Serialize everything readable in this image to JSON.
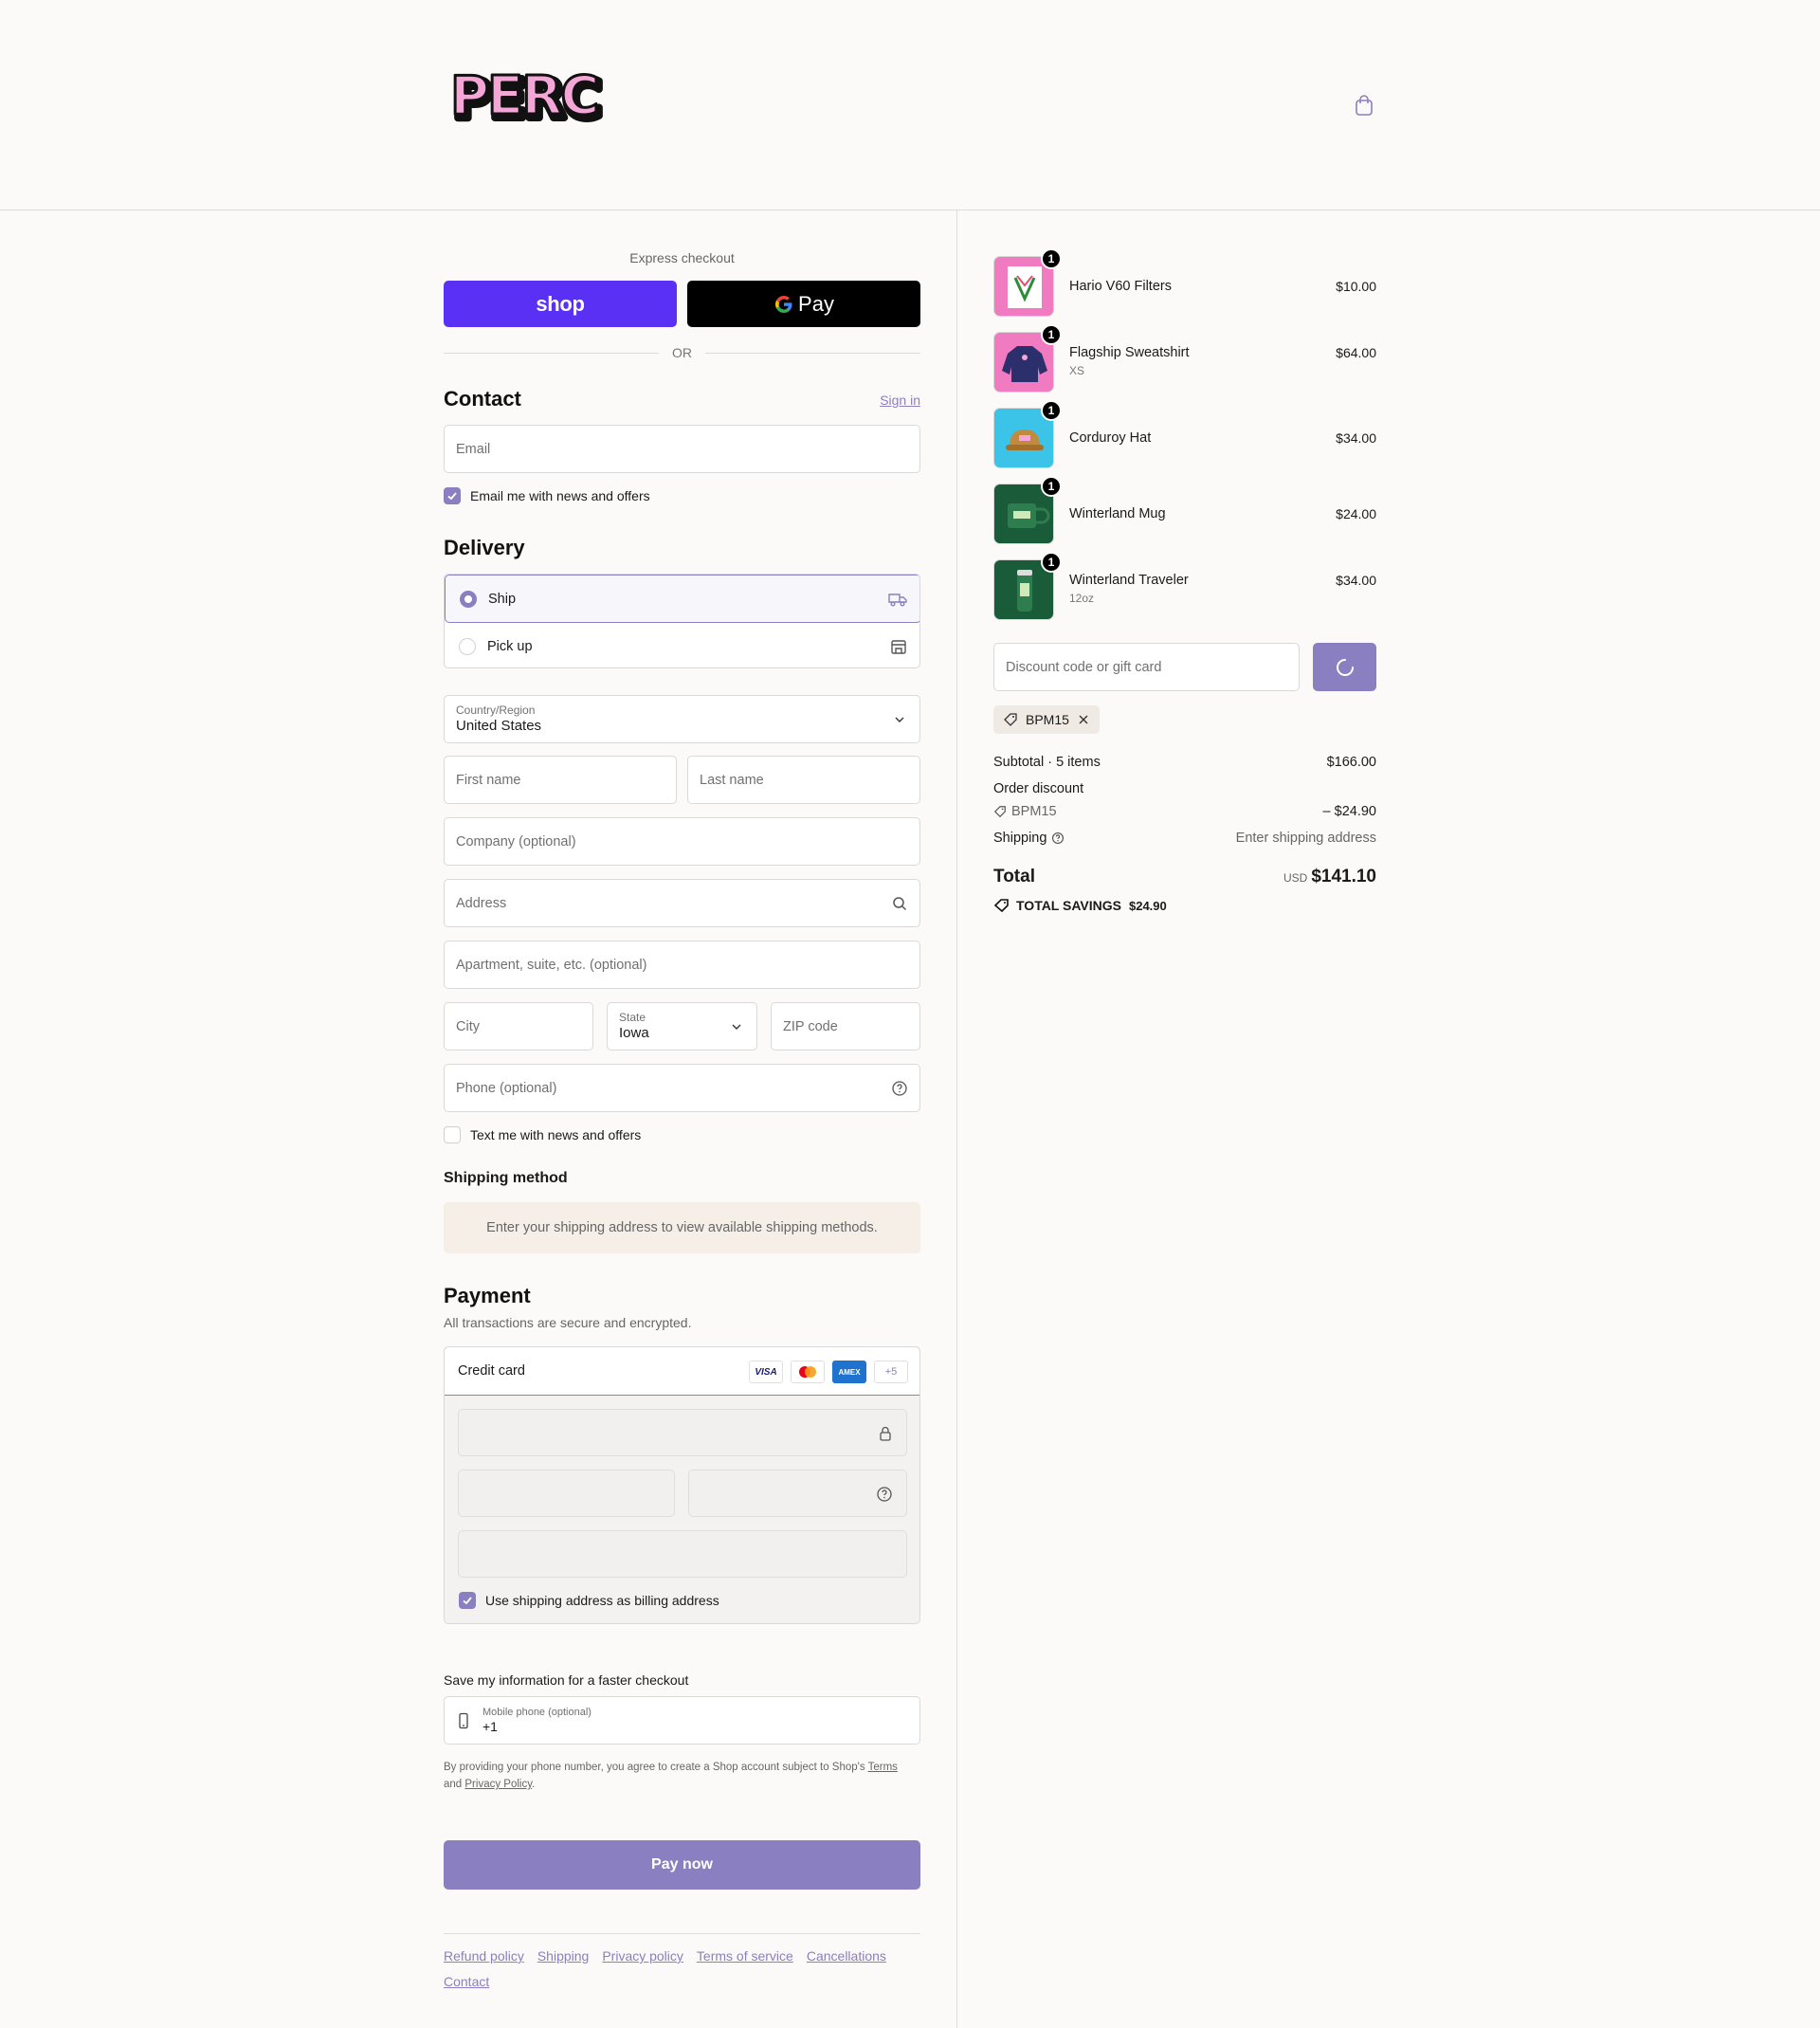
{
  "header": {
    "logo_text": "PERC",
    "cart_icon": "bag-icon"
  },
  "express": {
    "label": "Express checkout",
    "shop_label": "shop",
    "gpay_label": "Pay",
    "or_label": "OR"
  },
  "contact": {
    "title": "Contact",
    "sign_in": "Sign in",
    "email_placeholder": "Email",
    "news_label": "Email me with news and offers",
    "news_checked": true
  },
  "delivery": {
    "title": "Delivery",
    "options": [
      {
        "label": "Ship",
        "selected": true,
        "icon": "truck-icon"
      },
      {
        "label": "Pick up",
        "selected": false,
        "icon": "store-icon"
      }
    ],
    "country_label": "Country/Region",
    "country_value": "United States",
    "first_name": "First name",
    "last_name": "Last name",
    "company": "Company (optional)",
    "address": "Address",
    "apartment": "Apartment, suite, etc. (optional)",
    "city": "City",
    "state_label": "State",
    "state_value": "Iowa",
    "zip": "ZIP code",
    "phone": "Phone (optional)",
    "text_label": "Text me with news and offers",
    "text_checked": false
  },
  "shipping_method": {
    "title": "Shipping method",
    "message": "Enter your shipping address to view available shipping methods."
  },
  "payment": {
    "title": "Payment",
    "subtitle": "All transactions are secure and encrypted.",
    "method": "Credit card",
    "cards": [
      "VISA",
      "MC",
      "AMEX",
      "+5"
    ],
    "billing_label": "Use shipping address as billing address",
    "billing_checked": true
  },
  "save_info": {
    "title": "Save my information for a faster checkout",
    "phone_label": "Mobile phone (optional)",
    "phone_value": "+1",
    "legal_prefix": "By providing your phone number, you agree to create a Shop account subject to Shop's ",
    "legal_terms": "Terms",
    "legal_and": "and ",
    "legal_privacy": "Privacy Policy",
    "legal_end": "."
  },
  "pay_now": "Pay now",
  "footer_links": [
    "Refund policy",
    "Shipping",
    "Privacy policy",
    "Terms of service",
    "Cancellations",
    "Contact"
  ],
  "cart": {
    "items": [
      {
        "name": "Hario V60 Filters",
        "variant": "",
        "price": "$10.00",
        "qty": "1",
        "bg": "#f07bc0"
      },
      {
        "name": "Flagship Sweatshirt",
        "variant": "XS",
        "price": "$64.00",
        "qty": "1",
        "bg": "#f07bc0"
      },
      {
        "name": "Corduroy Hat",
        "variant": "",
        "price": "$34.00",
        "qty": "1",
        "bg": "#3cc3e8"
      },
      {
        "name": "Winterland Mug",
        "variant": "",
        "price": "$24.00",
        "qty": "1",
        "bg": "#1a5b3a"
      },
      {
        "name": "Winterland Traveler",
        "variant": "12oz",
        "price": "$34.00",
        "qty": "1",
        "bg": "#1a5b3a"
      }
    ],
    "discount_placeholder": "Discount code or gift card",
    "applied_code": "BPM15",
    "subtotal_label": "Subtotal · 5 items",
    "subtotal_value": "$166.00",
    "order_discount_label": "Order discount",
    "discount_code": "BPM15",
    "discount_value": "– $24.90",
    "shipping_label": "Shipping",
    "shipping_value": "Enter shipping address",
    "total_label": "Total",
    "currency": "USD",
    "total_value": "$141.10",
    "savings_label": "TOTAL SAVINGS",
    "savings_value": "$24.90"
  },
  "colors": {
    "accent": "#8a7fc0",
    "shop_purple": "#5a31f4",
    "logo_pink": "#f4a6d7"
  }
}
